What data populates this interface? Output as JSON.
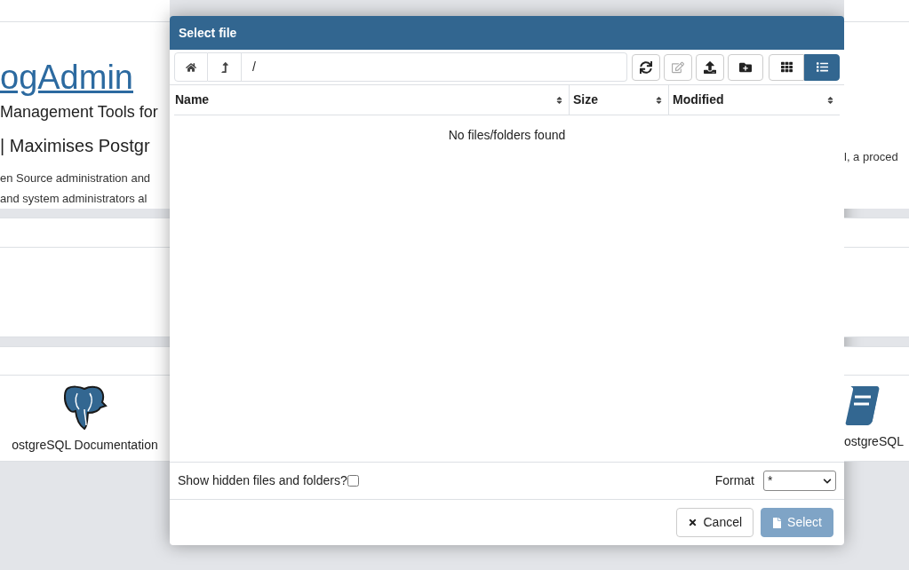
{
  "background": {
    "title": "ogAdmin",
    "subtitle": "Management Tools for",
    "tagline": "| Maximises Postgr",
    "description": [
      "en Source administration and",
      "and system administrators al"
    ],
    "description_right": "l, a proced",
    "links": [
      {
        "label": "ostgreSQL Documentation",
        "kind": "elephant"
      },
      {
        "label": "ostgreSQL",
        "kind": "book"
      }
    ]
  },
  "dialog": {
    "title": "Select file",
    "nav": [
      {
        "kind": "home"
      },
      {
        "kind": "up"
      }
    ],
    "path": "/",
    "toolbar": [
      {
        "kind": "refresh",
        "disabled": false
      },
      {
        "kind": "rename",
        "disabled": true
      },
      {
        "kind": "upload",
        "disabled": false
      },
      {
        "kind": "new-folder",
        "disabled": false
      }
    ],
    "views": [
      {
        "kind": "grid",
        "selected": false
      },
      {
        "kind": "list",
        "selected": true
      }
    ],
    "columns": [
      "Name",
      "Size",
      "Modified"
    ],
    "empty_message": "No files/folders found",
    "show_hidden": {
      "label": "Show hidden files and folders?",
      "checked": false
    },
    "format": {
      "label": "Format",
      "value": "*"
    },
    "buttons": [
      {
        "label": "Cancel",
        "kind": "cancel",
        "disabled": false
      },
      {
        "label": "Select",
        "kind": "select",
        "disabled": true
      }
    ]
  }
}
